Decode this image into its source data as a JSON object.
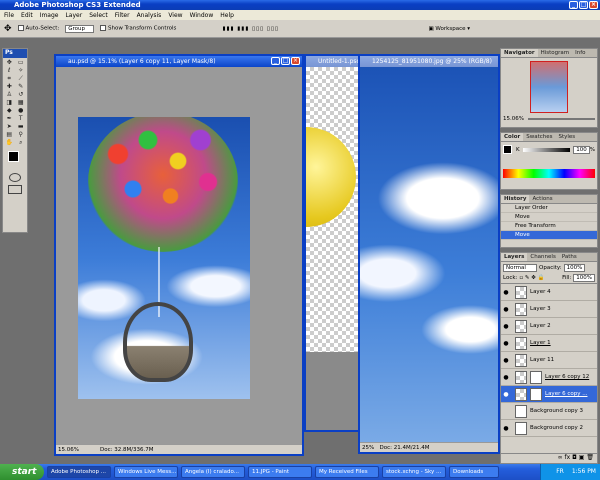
{
  "app": {
    "title": "Adobe Photoshop CS3 Extended"
  },
  "menu": [
    "File",
    "Edit",
    "Image",
    "Layer",
    "Select",
    "Filter",
    "Analysis",
    "View",
    "Window",
    "Help"
  ],
  "options": {
    "auto_select": "Auto-Select:",
    "auto_select_value": "Group",
    "show_transform": "Show Transform Controls",
    "workspace": "Workspace"
  },
  "tools": {
    "logo": "Ps"
  },
  "docs": [
    {
      "title": "au.psd @ 15.1% (Layer 6 copy 11, Layer Mask/8)",
      "zoom": "15.06%",
      "doc_size": "Doc: 32.8M/336.7M"
    },
    {
      "title": "Untitled-1.psd @"
    },
    {
      "title": "1254125_81951080.jpg @ 25% (RGB/8)",
      "zoom": "25%",
      "doc_size": "Doc: 21.4M/21.4M"
    }
  ],
  "navigator": {
    "tabs": [
      "Navigator",
      "Histogram",
      "Info"
    ],
    "zoom": "15.06%"
  },
  "color": {
    "tabs": [
      "Color",
      "Swatches",
      "Styles"
    ],
    "value": "100",
    "unit": "%",
    "label": "K"
  },
  "history": {
    "tabs": [
      "History",
      "Actions"
    ],
    "items": [
      "Layer Order",
      "Move",
      "Free Transform",
      "Move"
    ],
    "selected": 3
  },
  "layers": {
    "tabs": [
      "Layers",
      "Channels",
      "Paths"
    ],
    "mode": "Normal",
    "opacity_label": "Opacity:",
    "opacity": "100%",
    "lock_label": "Lock:",
    "fill_label": "Fill:",
    "fill": "100%",
    "items": [
      "Layer 4",
      "Layer 3",
      "Layer 2",
      "Layer 1",
      "Layer 11",
      "Layer 6 copy 12",
      "Layer 6 copy ...",
      "Background copy 3",
      "Background copy 2"
    ],
    "selected": 6
  },
  "taskbar": {
    "start": "start",
    "tasks": [
      "Adobe Photoshop ...",
      "Windows Live Mess...",
      "Angela (I) cralado...",
      "11.JPG - Paint",
      "My Received Files",
      "stock.xchng - Sky ...",
      "Downloads"
    ],
    "active": 0,
    "lang": "FR",
    "time": "1:56 PM"
  },
  "colors": {
    "accent": "#0a3fc4",
    "selection": "#3468d8"
  }
}
